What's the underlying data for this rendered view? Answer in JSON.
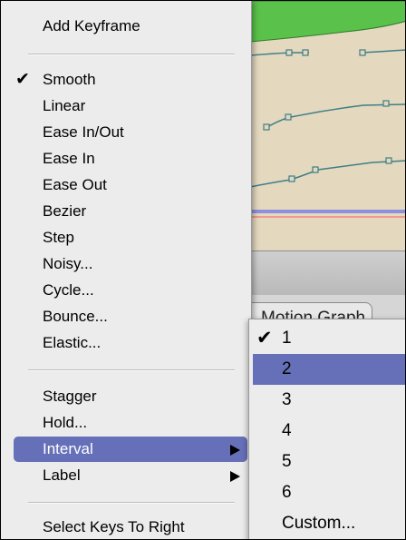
{
  "background": {
    "tab_label": "Motion Graph"
  },
  "menu": {
    "items": [
      {
        "label": "Add Keyframe",
        "checked": false,
        "submenu": false,
        "highlighted": false
      },
      {
        "label": "Smooth",
        "checked": true,
        "submenu": false,
        "highlighted": false
      },
      {
        "label": "Linear",
        "checked": false,
        "submenu": false,
        "highlighted": false
      },
      {
        "label": "Ease In/Out",
        "checked": false,
        "submenu": false,
        "highlighted": false
      },
      {
        "label": "Ease In",
        "checked": false,
        "submenu": false,
        "highlighted": false
      },
      {
        "label": "Ease Out",
        "checked": false,
        "submenu": false,
        "highlighted": false
      },
      {
        "label": "Bezier",
        "checked": false,
        "submenu": false,
        "highlighted": false
      },
      {
        "label": "Step",
        "checked": false,
        "submenu": false,
        "highlighted": false
      },
      {
        "label": "Noisy...",
        "checked": false,
        "submenu": false,
        "highlighted": false
      },
      {
        "label": "Cycle...",
        "checked": false,
        "submenu": false,
        "highlighted": false
      },
      {
        "label": "Bounce...",
        "checked": false,
        "submenu": false,
        "highlighted": false
      },
      {
        "label": "Elastic...",
        "checked": false,
        "submenu": false,
        "highlighted": false
      },
      {
        "label": "Stagger",
        "checked": false,
        "submenu": false,
        "highlighted": false
      },
      {
        "label": "Hold...",
        "checked": false,
        "submenu": false,
        "highlighted": false
      },
      {
        "label": "Interval",
        "checked": false,
        "submenu": true,
        "highlighted": true
      },
      {
        "label": "Label",
        "checked": false,
        "submenu": true,
        "highlighted": false
      },
      {
        "label": "Select Keys To Right",
        "checked": false,
        "submenu": false,
        "highlighted": false
      }
    ],
    "checkmark": "✔"
  },
  "interval_submenu": {
    "items": [
      {
        "label": "1",
        "checked": true,
        "highlighted": false
      },
      {
        "label": "2",
        "checked": false,
        "highlighted": true
      },
      {
        "label": "3",
        "checked": false,
        "highlighted": false
      },
      {
        "label": "4",
        "checked": false,
        "highlighted": false
      },
      {
        "label": "5",
        "checked": false,
        "highlighted": false
      },
      {
        "label": "6",
        "checked": false,
        "highlighted": false
      },
      {
        "label": "Custom...",
        "checked": false,
        "highlighted": false
      }
    ]
  },
  "colors": {
    "highlight": "#6670b8",
    "menu_bg": "#ececec",
    "graph_bg": "#e4d8bf",
    "curve": "#3f7f86",
    "green_track": "#5ac24a"
  }
}
